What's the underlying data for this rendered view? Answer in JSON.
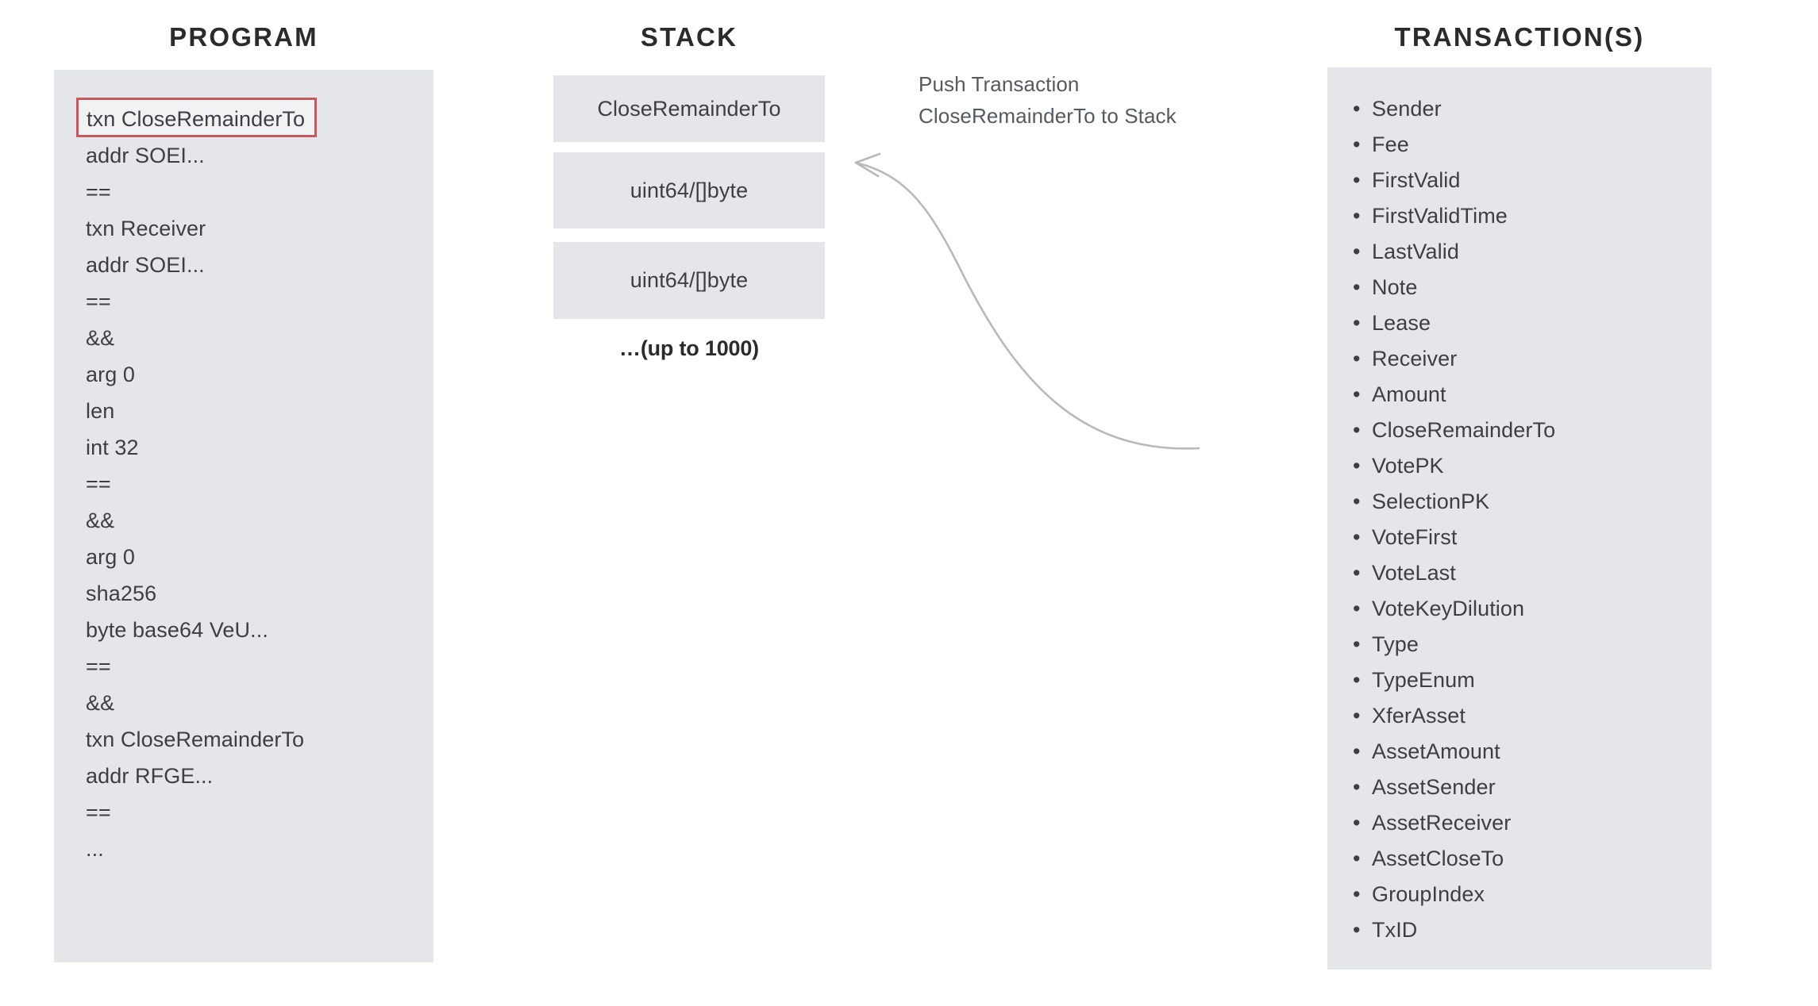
{
  "headings": {
    "program": "PROGRAM",
    "stack": "STACK",
    "transactions": "TRANSACTION(S)"
  },
  "program": {
    "lines": [
      {
        "text": "txn CloseRemainderTo",
        "highlighted": true
      },
      {
        "text": "addr SOEI...",
        "highlighted": false
      },
      {
        "text": "==",
        "highlighted": false
      },
      {
        "text": "txn Receiver",
        "highlighted": false
      },
      {
        "text": "addr SOEI...",
        "highlighted": false
      },
      {
        "text": "==",
        "highlighted": false
      },
      {
        "text": "&&",
        "highlighted": false
      },
      {
        "text": "arg 0",
        "highlighted": false
      },
      {
        "text": "len",
        "highlighted": false
      },
      {
        "text": "int 32",
        "highlighted": false
      },
      {
        "text": "==",
        "highlighted": false
      },
      {
        "text": "&&",
        "highlighted": false
      },
      {
        "text": "arg 0",
        "highlighted": false
      },
      {
        "text": "sha256",
        "highlighted": false
      },
      {
        "text": "byte base64 VeU...",
        "highlighted": false
      },
      {
        "text": "==",
        "highlighted": false
      },
      {
        "text": "&&",
        "highlighted": false
      },
      {
        "text": "txn CloseRemainderTo",
        "highlighted": false
      },
      {
        "text": "addr RFGE...",
        "highlighted": false
      },
      {
        "text": "==",
        "highlighted": false
      },
      {
        "text": "...",
        "highlighted": false
      }
    ]
  },
  "stack": {
    "boxes": [
      {
        "label": "CloseRemainderTo"
      },
      {
        "label": "uint64/[]byte"
      },
      {
        "label": "uint64/[]byte"
      }
    ],
    "more_label": "…(up to 1000)"
  },
  "transactions": {
    "bullet": "•",
    "fields": [
      "Sender",
      "Fee",
      "FirstValid",
      "FirstValidTime",
      "LastValid",
      "Note",
      "Lease",
      "Receiver",
      "Amount",
      "CloseRemainderTo",
      "VotePK",
      "SelectionPK",
      "VoteFirst",
      "VoteLast",
      "VoteKeyDilution",
      "Type",
      "TypeEnum",
      "XferAsset",
      "AssetAmount",
      "AssetSender",
      "AssetReceiver",
      "AssetCloseTo",
      "GroupIndex",
      "TxID"
    ]
  },
  "annotation": {
    "line1": "Push Transaction",
    "line2": "CloseRemainderTo to Stack"
  },
  "colors": {
    "panel_background": "#e4e6e9",
    "highlight_border": "#c45a60",
    "text": "#3c4043",
    "heading": "#2b2b2b",
    "arrow": "#b9b9b9",
    "page_background": "#ffffff"
  }
}
